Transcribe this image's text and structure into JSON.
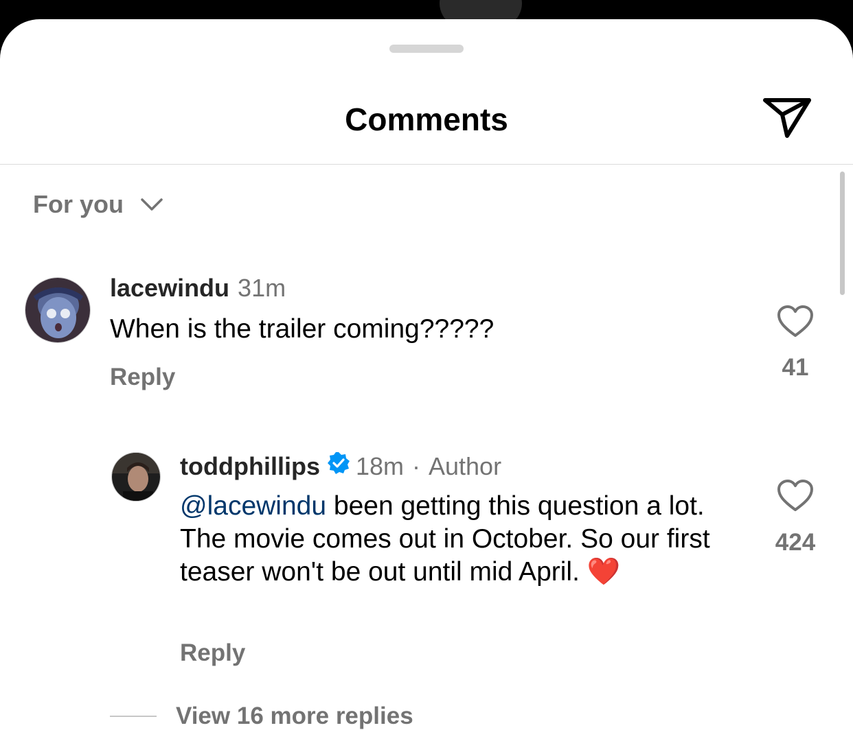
{
  "sheet": {
    "title": "Comments",
    "share_icon": "paper-plane-icon"
  },
  "sort": {
    "label": "For you",
    "icon": "chevron-down-icon"
  },
  "comments": [
    {
      "username": "lacewindu",
      "time": "31m",
      "text": "When is the trailer coming?????",
      "reply_label": "Reply",
      "likes": "41",
      "like_icon": "heart-outline-icon"
    },
    {
      "username": "toddphillips",
      "verified": true,
      "time": "18m",
      "separator": "·",
      "author_label": "Author",
      "mention": "@lacewindu",
      "text": " been getting this question a lot. The movie comes out in October. So our first teaser won't be out until mid April. ",
      "emoji": "❤️",
      "reply_label": "Reply",
      "likes": "424",
      "like_icon": "heart-outline-icon"
    }
  ],
  "view_more": {
    "label": "View 16 more replies"
  },
  "colors": {
    "background": "#ffffff",
    "text_primary": "#000000",
    "text_secondary": "#737373",
    "mention": "#00376b",
    "verified_badge": "#0095f6",
    "divider": "#dbdbdb"
  }
}
